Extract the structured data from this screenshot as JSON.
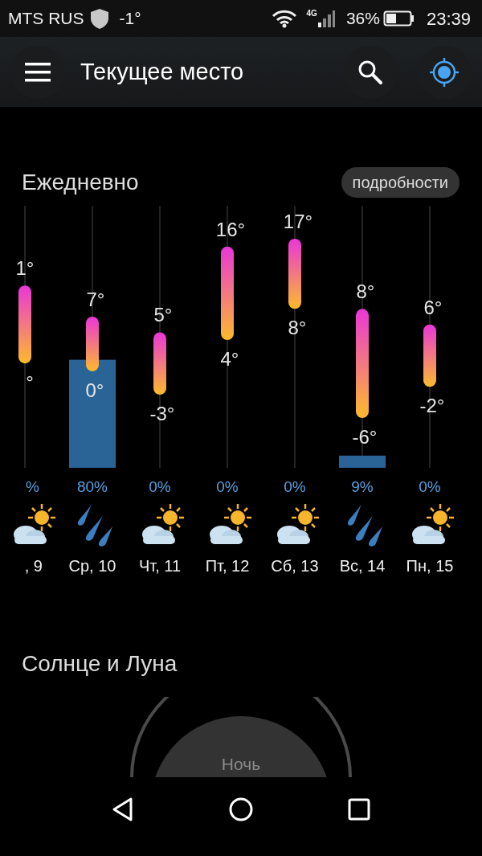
{
  "status_bar": {
    "carrier": "MTS RUS",
    "weather": "-1°",
    "network": "4G",
    "battery": "36%",
    "time": "23:39"
  },
  "header": {
    "title": "Текущее место"
  },
  "daily": {
    "title": "Ежедневно",
    "details_button": "подробности",
    "days": [
      {
        "high": "1°",
        "low": "°",
        "precip": "%",
        "kind": "partly-sunny",
        "date": ", 9"
      },
      {
        "high": "7°",
        "low": "0°",
        "precip": "80%",
        "kind": "rain",
        "date": "Ср, 10"
      },
      {
        "high": "5°",
        "low": "-3°",
        "precip": "0%",
        "kind": "partly-sunny",
        "date": "Чт, 11"
      },
      {
        "high": "16°",
        "low": "4°",
        "precip": "0%",
        "kind": "partly-sunny",
        "date": "Пт, 12"
      },
      {
        "high": "17°",
        "low": "8°",
        "precip": "0%",
        "kind": "partly-sunny",
        "date": "Сб, 13"
      },
      {
        "high": "8°",
        "low": "-6°",
        "precip": "9%",
        "kind": "rain",
        "date": "Вс, 14"
      },
      {
        "high": "6°",
        "low": "-2°",
        "precip": "0%",
        "kind": "partly-sunny",
        "date": "Пн, 15"
      }
    ]
  },
  "sun_moon": {
    "title": "Солнце и Луна",
    "phase": "Ночь"
  }
}
